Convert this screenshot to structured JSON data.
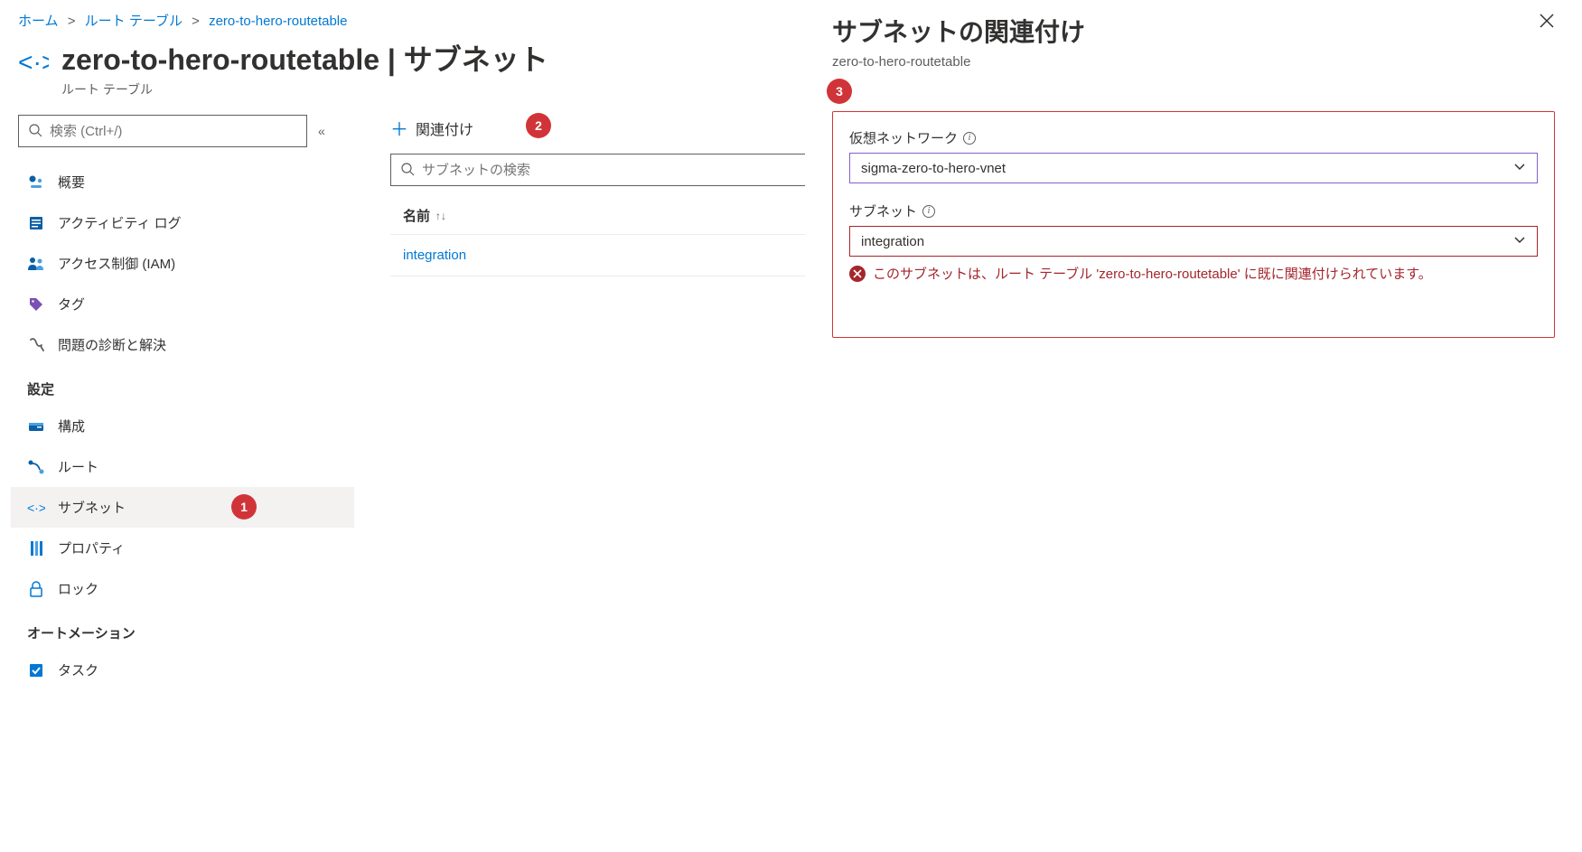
{
  "breadcrumb": {
    "home": "ホーム",
    "route_tables": "ルート テーブル",
    "current": "zero-to-hero-routetable"
  },
  "header": {
    "title": "zero-to-hero-routetable | サブネット",
    "subtitle": "ルート テーブル"
  },
  "search": {
    "placeholder": "検索 (Ctrl+/)"
  },
  "nav": {
    "overview": "概要",
    "activity_log": "アクティビティ ログ",
    "iam": "アクセス制御 (IAM)",
    "tags": "タグ",
    "diagnose": "問題の診断と解決",
    "section_settings": "設定",
    "configuration": "構成",
    "routes": "ルート",
    "subnets": "サブネット",
    "properties": "プロパティ",
    "lock": "ロック",
    "section_automation": "オートメーション",
    "tasks": "タスク"
  },
  "content": {
    "associate": "関連付け",
    "subnet_search_placeholder": "サブネットの検索",
    "col_name": "名前",
    "row0": "integration"
  },
  "badges": {
    "b1": "1",
    "b2": "2",
    "b3": "3"
  },
  "panel": {
    "title": "サブネットの関連付け",
    "subtitle": "zero-to-hero-routetable",
    "vnet_label": "仮想ネットワーク",
    "vnet_value": "sigma-zero-to-hero-vnet",
    "subnet_label": "サブネット",
    "subnet_value": "integration",
    "error": "このサブネットは、ルート テーブル 'zero-to-hero-routetable' に既に関連付けられています。"
  }
}
